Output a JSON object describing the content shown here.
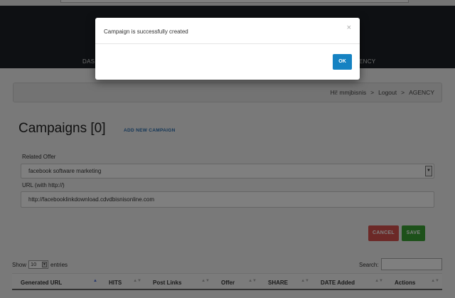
{
  "nav": {
    "left_label": "DASI",
    "right_label": "ENCY"
  },
  "breadcrumb": {
    "greeting": "Hi! mmjbisnis",
    "sep1": ">",
    "logout": "Logout",
    "sep2": ">",
    "section": "AGENCY"
  },
  "page": {
    "title": "Campaigns [0]",
    "add_new": "ADD NEW CAMPAIGN"
  },
  "form": {
    "offer_label": "Related Offer",
    "offer_value": "facebook software marketing",
    "url_label": "URL (with http://)",
    "url_value": "http://facebooklinkdownload.cdvdbisnisonline.com",
    "cancel_label": "CANCEL",
    "save_label": "SAVE"
  },
  "table": {
    "show_label": "Show",
    "show_value": "10",
    "entries_label": "entries",
    "search_label": "Search:",
    "columns": [
      "Generated URL",
      "HITS",
      "Post Links",
      "Offer",
      "SHARE",
      "DATE Added",
      "Actions"
    ]
  },
  "modal": {
    "message": "Campaign is successfully created",
    "close_glyph": "×",
    "ok_label": "OK"
  },
  "colors": {
    "header_bg": "#1c2127",
    "primary": "#1582c2",
    "cancel": "#d9534f",
    "save": "#3aa335"
  }
}
